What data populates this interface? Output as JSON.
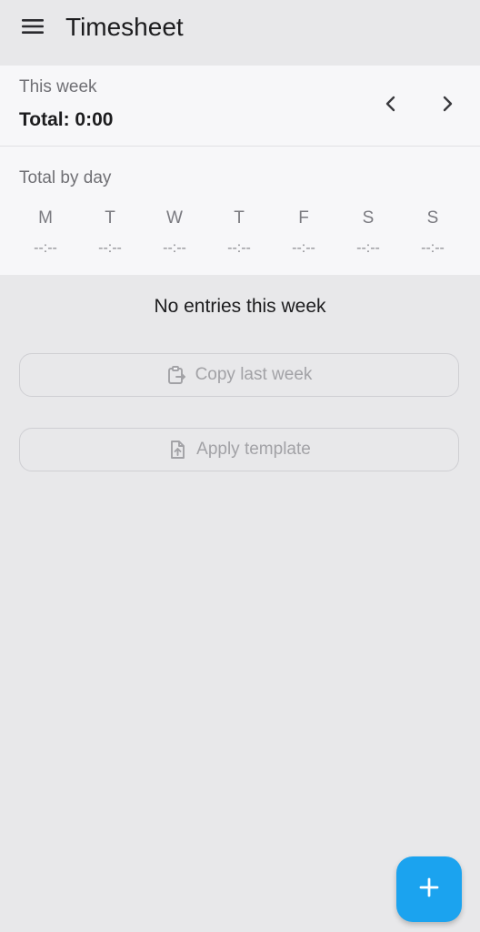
{
  "app_bar": {
    "title": "Timesheet",
    "menu_icon": "menu-icon"
  },
  "week": {
    "label": "This week",
    "total": "Total: 0:00",
    "prev_icon": "chevron-left-icon",
    "next_icon": "chevron-right-icon"
  },
  "day_totals": {
    "title": "Total by day",
    "days": [
      {
        "letter": "M",
        "value": "--:--"
      },
      {
        "letter": "T",
        "value": "--:--"
      },
      {
        "letter": "W",
        "value": "--:--"
      },
      {
        "letter": "T",
        "value": "--:--"
      },
      {
        "letter": "F",
        "value": "--:--"
      },
      {
        "letter": "S",
        "value": "--:--"
      },
      {
        "letter": "S",
        "value": "--:--"
      }
    ]
  },
  "empty_state": {
    "message": "No entries this week"
  },
  "actions": {
    "copy_last_week": "Copy last week",
    "apply_template": "Apply template"
  },
  "fab": {
    "icon": "plus-icon"
  },
  "colors": {
    "background": "#e8e8ea",
    "card": "#f7f7f9",
    "accent": "#1ba3ef"
  }
}
